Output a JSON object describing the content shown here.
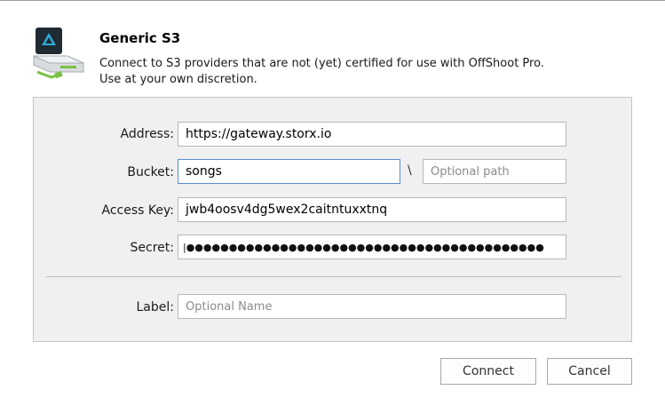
{
  "header": {
    "title": "Generic S3",
    "description_line1": "Connect to S3 providers that are not (yet) certified for use with OffShoot Pro.",
    "description_line2": "Use at your own discretion.",
    "icon": "server-drive-icon"
  },
  "form": {
    "address": {
      "label": "Address:",
      "value": "https://gateway.storx.io"
    },
    "bucket": {
      "label": "Bucket:",
      "value": "songs"
    },
    "path_separator": "\\",
    "path": {
      "placeholder": "Optional path"
    },
    "access_key": {
      "label": "Access Key:",
      "value": "jwb4oosv4dg5wex2caitntuxxtnq"
    },
    "secret": {
      "label": "Secret:",
      "masked_value": "|●●●●●●●●●●●●●●●●●●●●●●●●●●●●●●●●●●●●●●●●●●"
    },
    "label": {
      "label": "Label:",
      "placeholder": "Optional Name"
    }
  },
  "buttons": {
    "connect": "Connect",
    "cancel": "Cancel"
  },
  "colors": {
    "focus_border": "#5a8ed0",
    "panel_bg": "#f0f0f0",
    "icon_blue": "#2ea9d6",
    "icon_green": "#7ac143"
  }
}
